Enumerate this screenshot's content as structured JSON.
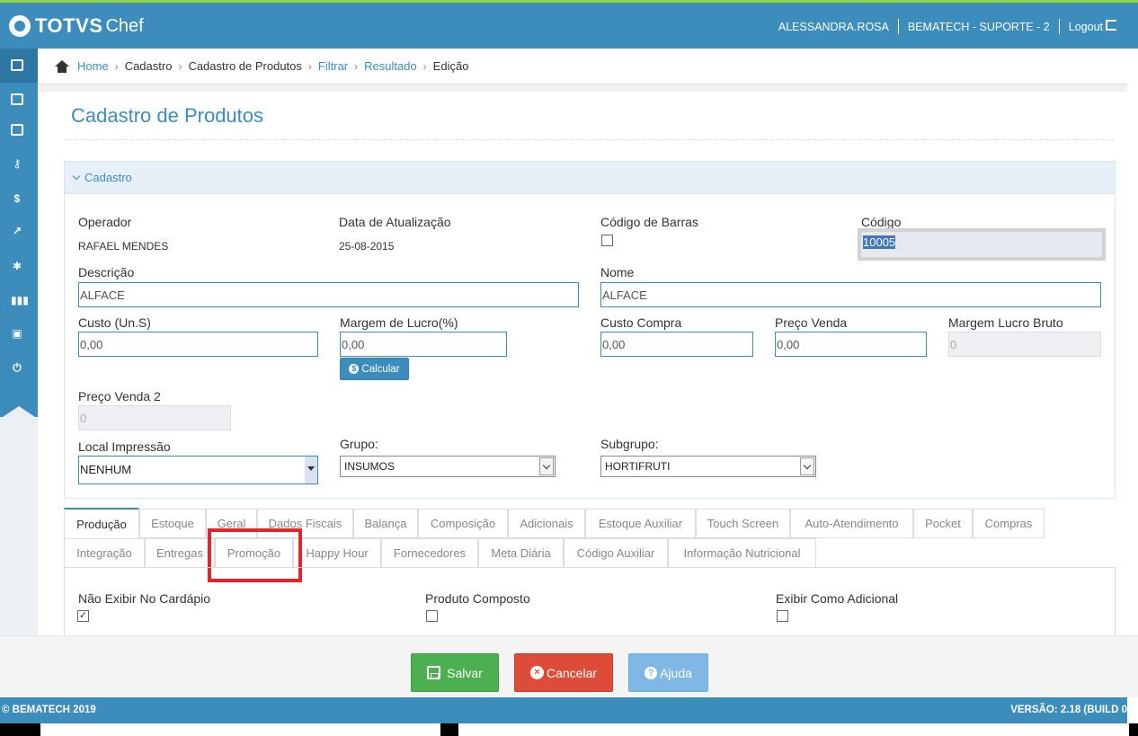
{
  "header": {
    "brand": "TOTVS",
    "product": "Chef",
    "user": "ALESSANDRA.ROSA",
    "company": "BEMATECH - SUPORTE - 2",
    "logout": "Logout"
  },
  "sidebar": {
    "icons": [
      "id-card-icon",
      "id-card-icon",
      "id-card-icon",
      "key-icon",
      "dollar-icon",
      "chart-icon",
      "gear-icon",
      "barcode-icon",
      "print-icon",
      "power-icon"
    ]
  },
  "breadcrumb": {
    "items": [
      {
        "label": "Home",
        "link": true
      },
      {
        "label": "Cadastro",
        "link": false
      },
      {
        "label": "Cadastro de Produtos",
        "link": false
      },
      {
        "label": "Filtrar",
        "link": true
      },
      {
        "label": "Resultado",
        "link": true
      },
      {
        "label": "Edição",
        "link": false
      }
    ]
  },
  "page": {
    "title": "Cadastro de Produtos",
    "panel_title": "Cadastro"
  },
  "form": {
    "operador_label": "Operador",
    "operador_value": "RAFAEL MENDES",
    "data_label": "Data de Atualização",
    "data_value": "25-08-2015",
    "codigo_barras_label": "Código de Barras",
    "codigo_label": "Código",
    "codigo_value": "10005",
    "descricao_label": "Descrição",
    "descricao_value": "ALFACE",
    "nome_label": "Nome",
    "nome_value": "ALFACE",
    "custo_label": "Custo (Un.S)",
    "custo_value": "0,00",
    "margem_label": "Margem de Lucro(%)",
    "margem_value": "0,00",
    "calcular_label": "Calcular",
    "custo_compra_label": "Custo Compra",
    "custo_compra_value": "0,00",
    "preco_venda_label": "Preço Venda",
    "preco_venda_value": "0,00",
    "margem_bruto_label": "Margem Lucro Bruto",
    "margem_bruto_value": "0",
    "preco_venda2_label": "Preço Venda 2",
    "preco_venda2_value": "0",
    "local_impressao_label": "Local Impressão",
    "local_impressao_value": "NENHUM",
    "grupo_label": "Grupo:",
    "grupo_value": "INSUMOS",
    "subgrupo_label": "Subgrupo:",
    "subgrupo_value": "HORTIFRUTI"
  },
  "tabs": {
    "row1": [
      "Produção",
      "Estoque",
      "Geral",
      "Dados Fiscais",
      "Balança",
      "Composição",
      "Adicionais",
      "Estoque Auxiliar",
      "Touch Screen",
      "Auto-Atendimento",
      "Pocket",
      "Compras"
    ],
    "row2": [
      "Integração",
      "Entregas",
      "Promoção",
      "Happy Hour",
      "Fornecedores",
      "Meta Diária",
      "Código Auxiliar",
      "Informação Nutricional"
    ],
    "active": "Produção",
    "highlighted": "Promoção"
  },
  "producao": {
    "nao_exibir_label": "Não Exibir No Cardápio",
    "nao_exibir_checked": true,
    "produto_composto_label": "Produto Composto",
    "produto_composto_checked": false,
    "exibir_adicional_label": "Exibir Como Adicional",
    "exibir_adicional_checked": false
  },
  "actions": {
    "save": "Salvar",
    "cancel": "Cancelar",
    "help": "Ajuda"
  },
  "footer": {
    "copyright": "© BEMATECH 2019",
    "version": "VERSÃO: 2.18 (BUILD 0"
  }
}
